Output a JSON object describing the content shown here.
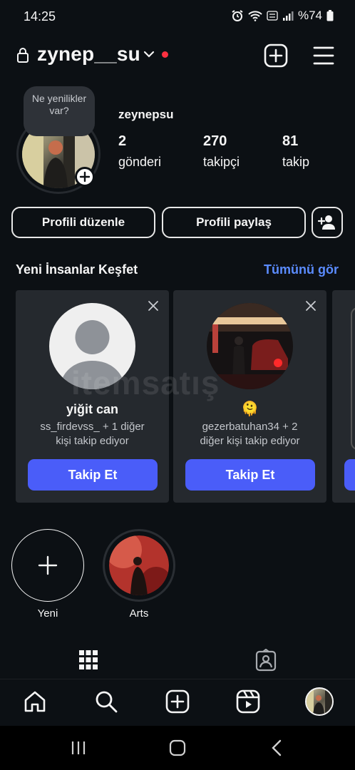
{
  "status_bar": {
    "time": "14:25",
    "battery": "%74"
  },
  "header": {
    "username": "zynep__su"
  },
  "profile": {
    "note": "Ne yenilikler var?",
    "display_name": "zeynepsu",
    "stats": [
      {
        "value": "2",
        "label": "gönderi"
      },
      {
        "value": "270",
        "label": "takipçi"
      },
      {
        "value": "81",
        "label": "takip"
      }
    ],
    "edit_label": "Profili düzenle",
    "share_label": "Profili paylaş"
  },
  "discover": {
    "title": "Yeni İnsanlar Keşfet",
    "see_all": "Tümünü gör",
    "cards": [
      {
        "name": "yiğit can",
        "subtitle_1": "ss_firdevss_ + 1 diğer",
        "subtitle_2": "kişi takip ediyor",
        "button": "Takip Et"
      },
      {
        "emoji": "🫠",
        "subtitle_1": "gezerbatuhan34 + 2",
        "subtitle_2": "diğer kişi takip ediyor",
        "button": "Takip Et"
      }
    ]
  },
  "watermark": "itemsatış",
  "highlights": [
    {
      "label": "Yeni"
    },
    {
      "label": "Arts"
    }
  ],
  "colors": {
    "accent": "#4a5df9",
    "link": "#5b8cff",
    "background": "#0c1014",
    "card": "#25292e",
    "live_dot": "#ff3040"
  }
}
